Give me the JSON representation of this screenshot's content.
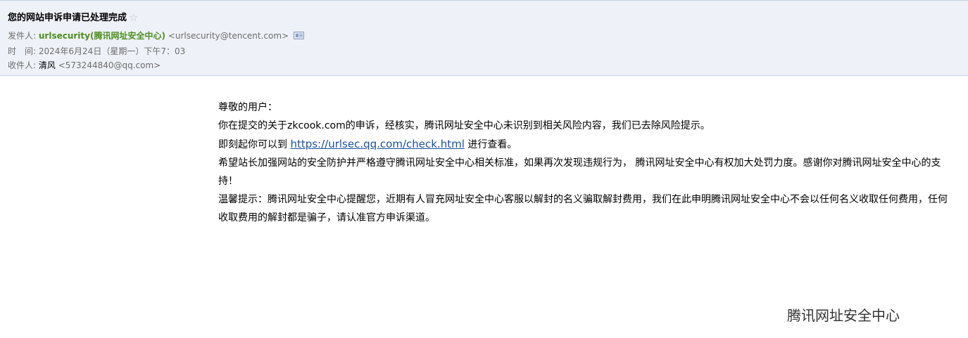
{
  "header": {
    "subject": "您的网站申诉申请已处理完成",
    "star_icon": "star-icon",
    "from_label": "发件人:",
    "from_name": "urlsecurity(腾讯网址安全中心)",
    "from_email": "<urlsecurity@tencent.com>",
    "vcard_icon": "vcard-icon",
    "time_label": "时　间:",
    "time_value": "2024年6月24日（星期一）下午7：03",
    "to_label": "收件人:",
    "to_name": "清风",
    "to_email": "<573244840@qq.com>"
  },
  "body": {
    "greeting": "尊敬的用户：",
    "line1": "你在提交的关于zkcook.com的申诉，经核实，腾讯网址安全中心未识别到相关风险内容，我们已去除风险提示。",
    "line2_prefix": "即刻起你可以到 ",
    "line2_link": "https://urlsec.qq.com/check.html",
    "line2_suffix": " 进行查看。",
    "line3": "希望站长加强网站的安全防护并严格遵守腾讯网址安全中心相关标准，如果再次发现违规行为， 腾讯网址安全中心有权加大处罚力度。感谢你对腾讯网址安全中心的支持！",
    "line4": "温馨提示：腾讯网址安全中心提醒您，近期有人冒充网址安全中心客服以解封的名义骗取解封费用，我们在此申明腾讯网址安全中心不会以任何名义收取任何费用，任何收取费用的解封都是骗子，请认准官方申诉渠道。"
  },
  "signature": "腾讯网址安全中心",
  "colors": {
    "header_bg": "#eef1f8",
    "sender_green": "#4d8f1f",
    "link_blue": "#1a4f9c",
    "meta_gray": "#6d6d6d"
  }
}
